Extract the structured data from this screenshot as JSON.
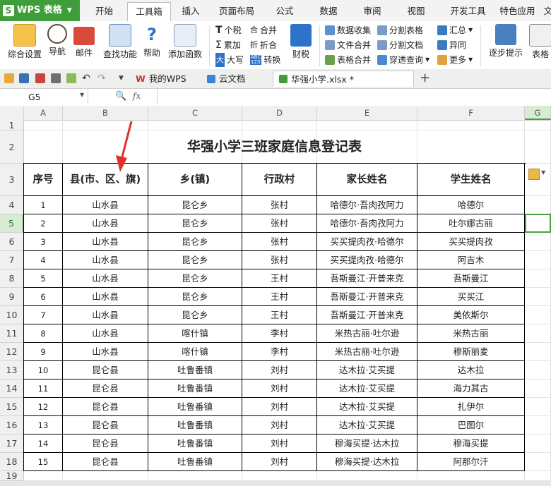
{
  "menubar": {
    "app_name": "WPS 表格",
    "tabs": [
      "开始",
      "工具箱",
      "插入",
      "页面布局",
      "公式",
      "数据",
      "审阅",
      "视图",
      "开发工具",
      "特色应用",
      "文"
    ],
    "active_tab": "工具箱"
  },
  "ribbon": {
    "big": [
      "综合设置",
      "导航",
      "邮件",
      "查找功能",
      "帮助",
      "添加函数",
      "财税",
      "逐步提示",
      "表格"
    ],
    "small": [
      "个税",
      "累加",
      "大写",
      "合并",
      "折合",
      "转换",
      "数据收集",
      "文件合并",
      "表格合并",
      "分割表格",
      "分割文档",
      "穿透查询",
      "汇总",
      "异同",
      "更多"
    ],
    "small_marks": [
      "T",
      "Σ",
      "大",
      "合",
      "折",
      "ABC\n123"
    ]
  },
  "doc_tabs": [
    "我的WPS",
    "云文档",
    "华强小学.xlsx *"
  ],
  "formula_bar": {
    "name_box": "G5",
    "fx": "fx"
  },
  "columns": [
    "A",
    "B",
    "C",
    "D",
    "E",
    "F",
    "G"
  ],
  "rows": [
    "1",
    "2",
    "3",
    "4",
    "5",
    "6",
    "7",
    "8",
    "9",
    "10",
    "11",
    "12",
    "13",
    "14",
    "15",
    "16",
    "17",
    "18",
    "19"
  ],
  "sheet": {
    "title": "华强小学三班家庭信息登记表",
    "headers": [
      "序号",
      "县(市、区、旗)",
      "乡(镇)",
      "行政村",
      "家长姓名",
      "学生姓名"
    ],
    "data": [
      [
        "1",
        "山水县",
        "昆仑乡",
        "张村",
        "哈德尔·吾肉孜阿力",
        "哈德尔"
      ],
      [
        "2",
        "山水县",
        "昆仑乡",
        "张村",
        "哈德尔·吾肉孜阿力",
        "吐尔娜古丽"
      ],
      [
        "3",
        "山水县",
        "昆仑乡",
        "张村",
        "买买提肉孜·哈德尔",
        "买买提肉孜"
      ],
      [
        "4",
        "山水县",
        "昆仑乡",
        "张村",
        "买买提肉孜·哈德尔",
        "阿吉木"
      ],
      [
        "5",
        "山水县",
        "昆仑乡",
        "王村",
        "吾斯曼江·开普来克",
        "吾斯曼江"
      ],
      [
        "6",
        "山水县",
        "昆仑乡",
        "王村",
        "吾斯曼江·开普来克",
        "买买江"
      ],
      [
        "7",
        "山水县",
        "昆仑乡",
        "王村",
        "吾斯曼江·开普来克",
        "美依斯尔"
      ],
      [
        "8",
        "山水县",
        "喀什镇",
        "李村",
        "米热古丽·吐尔逊",
        "米热古丽"
      ],
      [
        "9",
        "山水县",
        "喀什镇",
        "李村",
        "米热古丽·吐尔逊",
        "穆斯丽麦"
      ],
      [
        "10",
        "昆仑县",
        "吐鲁番镇",
        "刘村",
        "达木拉·艾买提",
        "达木拉"
      ],
      [
        "11",
        "昆仑县",
        "吐鲁番镇",
        "刘村",
        "达木拉·艾买提",
        "海力其古"
      ],
      [
        "12",
        "昆仑县",
        "吐鲁番镇",
        "刘村",
        "达木拉·艾买提",
        "扎伊尔"
      ],
      [
        "13",
        "昆仑县",
        "吐鲁番镇",
        "刘村",
        "达木拉·艾买提",
        "巴图尔"
      ],
      [
        "14",
        "昆仑县",
        "吐鲁番镇",
        "刘村",
        "穆海买提·达木拉",
        "穆海买提"
      ],
      [
        "15",
        "昆仑县",
        "吐鲁番镇",
        "刘村",
        "穆海买提·达木拉",
        "阿那尔汗"
      ]
    ]
  },
  "colors": {
    "accent_green": "#3f9d3a",
    "selection": "#46a33f",
    "annotation_arrow": "#e0312b"
  }
}
